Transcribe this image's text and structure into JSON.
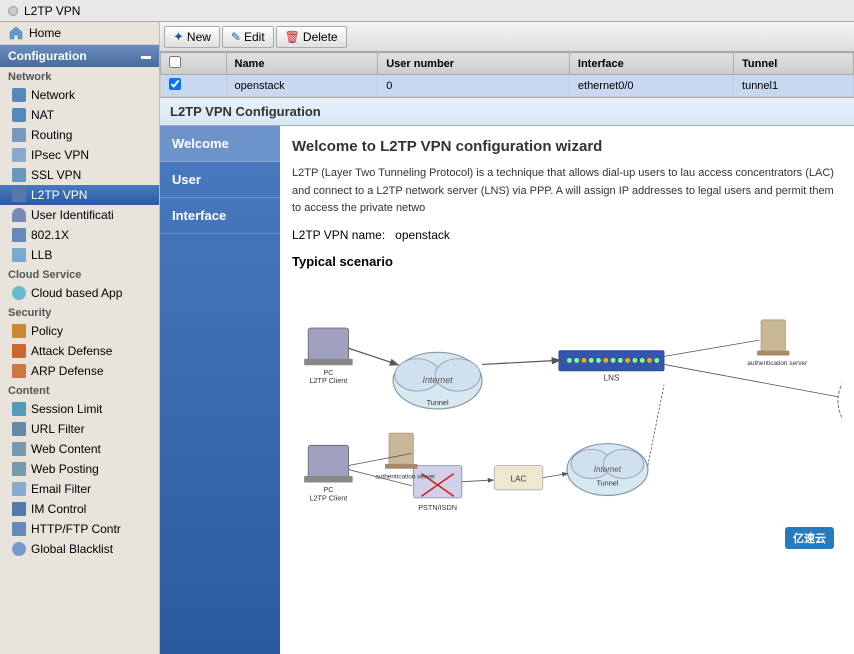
{
  "topbar": {
    "dot_color": "#ccc",
    "title": "L2TP VPN"
  },
  "toolbar": {
    "new_label": "New",
    "edit_label": "Edit",
    "delete_label": "Delete"
  },
  "sidebar": {
    "home_label": "Home",
    "configuration_label": "Configuration",
    "network_group": "Network",
    "network_label": "Network",
    "nat_label": "NAT",
    "routing_label": "Routing",
    "ipsec_label": "IPsec VPN",
    "ssl_label": "SSL VPN",
    "l2tp_label": "L2TP VPN",
    "user_id_label": "User Identificati",
    "8021x_label": "802.1X",
    "llb_label": "LLB",
    "cloud_group": "Cloud Service",
    "cloud_app_label": "Cloud based App",
    "security_group": "Security",
    "policy_label": "Policy",
    "attack_label": "Attack Defense",
    "arp_label": "ARP Defense",
    "content_group": "Content",
    "session_label": "Session Limit",
    "url_label": "URL Filter",
    "web_content_label": "Web Content",
    "web_posting_label": "Web Posting",
    "email_label": "Email Filter",
    "im_label": "IM Control",
    "http_label": "HTTP/FTP Contr",
    "global_label": "Global Blacklist"
  },
  "table": {
    "headers": [
      "",
      "Name",
      "User number",
      "Interface",
      "Tunnel"
    ],
    "rows": [
      {
        "checked": true,
        "name": "openstack",
        "user_number": "0",
        "interface": "ethernet0/0",
        "tunnel": "tunnel1"
      }
    ]
  },
  "wizard": {
    "header": "L2TP VPN Configuration",
    "nav_items": [
      "Welcome",
      "User",
      "Interface"
    ],
    "active_nav": "Welcome",
    "title": "Welcome to L2TP VPN configuration wizard",
    "description": "L2TP (Layer Two Tunneling Protocol) is a technique that allows dial-up users to lau access concentrators (LAC) and connect to a L2TP network server (LNS) via PPP. A will assign IP addresses to legal users and permit them to access the private netwo",
    "vpn_name_label": "L2TP VPN name:",
    "vpn_name_value": "openstack",
    "scenario_title": "Typical scenario"
  },
  "watermark": "亿速云"
}
